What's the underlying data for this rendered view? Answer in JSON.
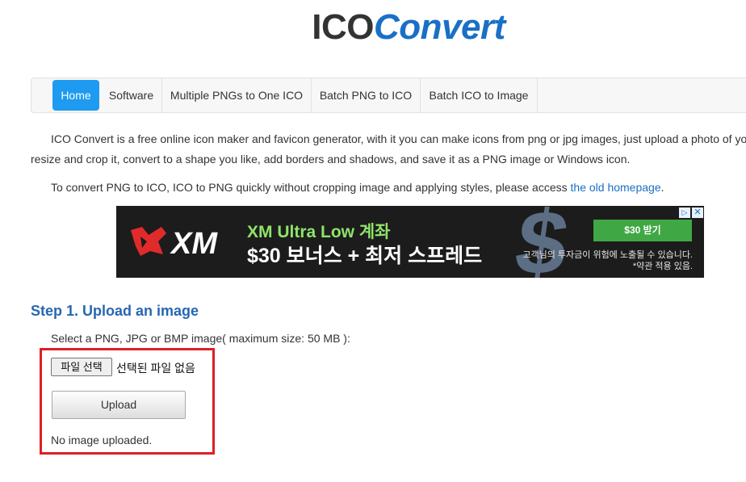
{
  "logo": {
    "part1": "ICO",
    "part2": "Convert"
  },
  "nav": {
    "items": [
      {
        "label": "Home",
        "active": true
      },
      {
        "label": "Software"
      },
      {
        "label": "Multiple PNGs to One ICO"
      },
      {
        "label": "Batch PNG to ICO"
      },
      {
        "label": "Batch ICO to Image"
      }
    ]
  },
  "intro": {
    "line1": "ICO Convert is a free online icon maker and favicon generator, with it you can make icons from png or jpg images, just upload a photo of yo",
    "line2": "resize and crop it, convert to a shape you like, add borders and shadows, and save it as a PNG image or Windows icon.",
    "line3_prefix": "To convert PNG to ICO, ICO to PNG quickly without cropping image and applying styles, please access ",
    "line3_link": "the old homepage",
    "line3_suffix": "."
  },
  "ad": {
    "brand": "XM",
    "headline": "XM Ultra Low 계좌",
    "subline": "$30 보너스 + 최저 스프레드",
    "cta": "$30 받기",
    "disclaimer1": "고객님의 투자금이 위험에 노출될 수 있습니다.",
    "disclaimer2": "*약관 적용 있음.",
    "adchoice_icon": "adchoices-icon",
    "close_symbol": "✕",
    "colors": {
      "background": "#1c1c1c",
      "headline": "#8fe36a",
      "cta": "#3fa844"
    }
  },
  "step1": {
    "title": "Step 1. Upload an image",
    "hint": "Select a PNG, JPG or BMP image( maximum size: 50 MB ):",
    "file_button": "파일 선택",
    "file_status": "선택된 파일 없음",
    "upload_button": "Upload",
    "status": "No image uploaded."
  },
  "colors": {
    "accent": "#1e9bf0",
    "link": "#1a6fc6",
    "step_title": "#2667b1",
    "highlight": "#dd1f26"
  }
}
